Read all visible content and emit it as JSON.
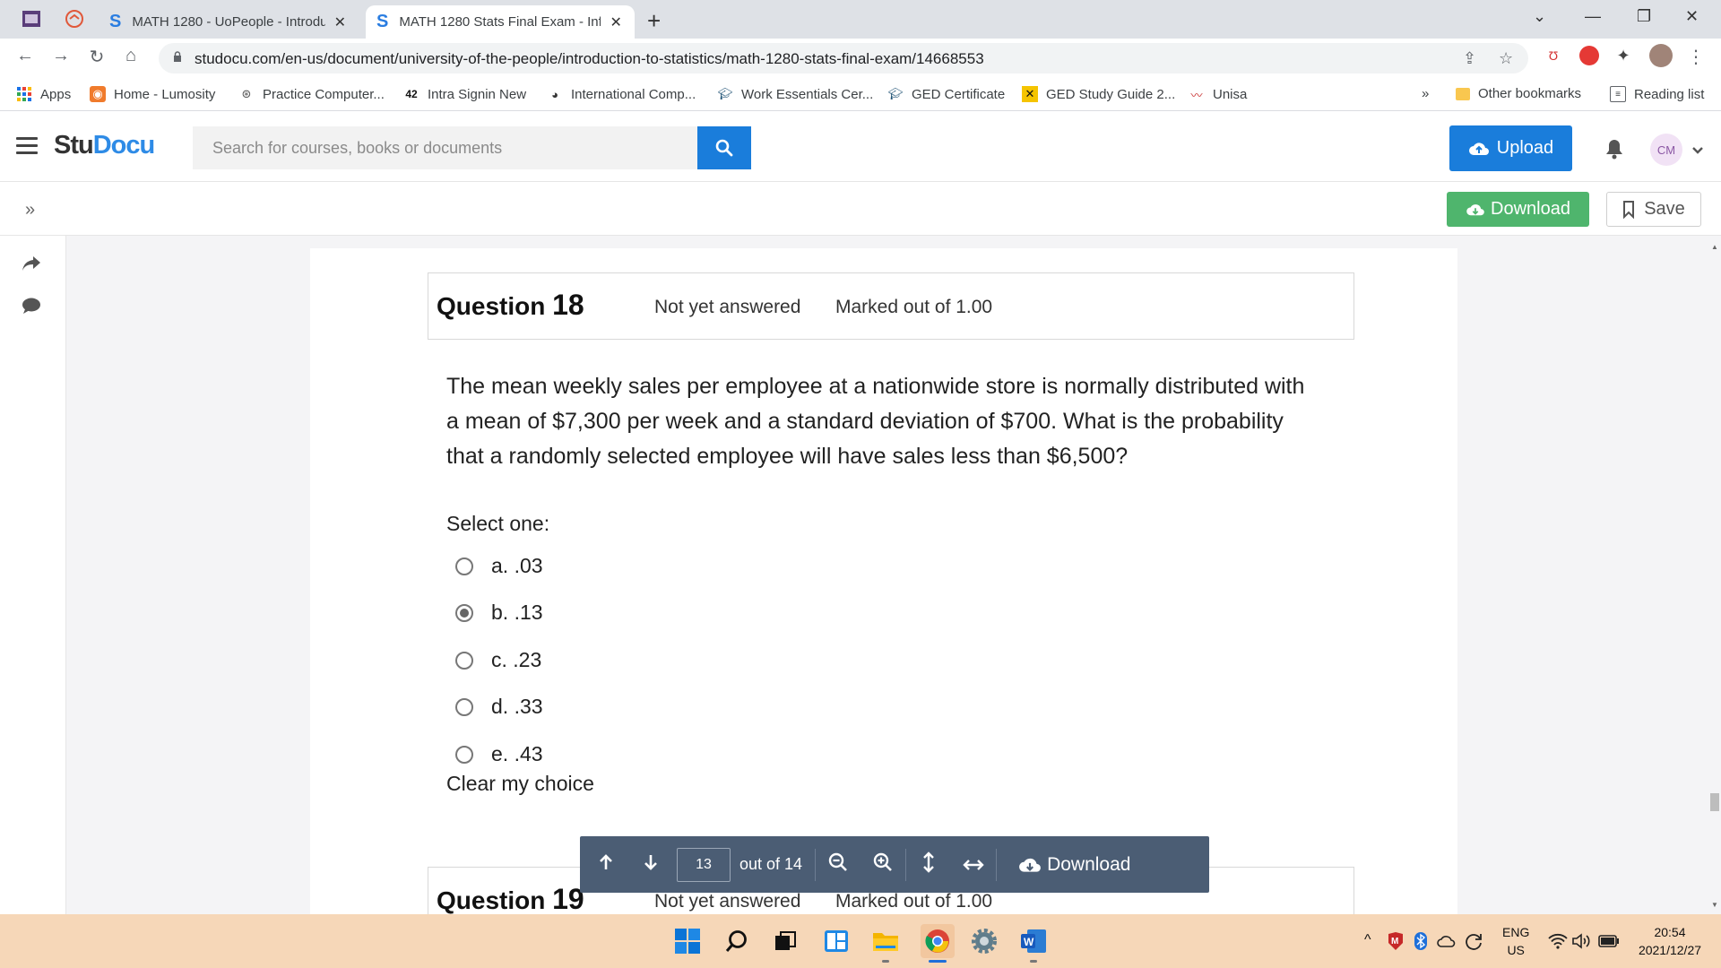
{
  "browser": {
    "tabs": [
      {
        "title": "MATH 1280 - UoPeople - Introdu",
        "active": false
      },
      {
        "title": "MATH 1280 Stats Final Exam - Inf",
        "active": true
      }
    ],
    "url": "studocu.com/en-us/document/university-of-the-people/introduction-to-statistics/math-1280-stats-final-exam/14668553",
    "bookmarks": [
      {
        "label": "Apps",
        "icon": "apps-grid-icon"
      },
      {
        "label": "Home - Lumosity",
        "icon": "lumosity-icon"
      },
      {
        "label": "Practice Computer...",
        "icon": "globe-icon"
      },
      {
        "label": "Intra Signin New",
        "icon": "intra-icon"
      },
      {
        "label": "International Comp...",
        "icon": "globe-icon"
      },
      {
        "label": "Work Essentials Cer...",
        "icon": "grad-cap-icon"
      },
      {
        "label": "GED Certificate",
        "icon": "grad-cap-icon"
      },
      {
        "label": "GED Study Guide 2...",
        "icon": "ged-icon"
      },
      {
        "label": "Unisa",
        "icon": "unisa-icon"
      }
    ],
    "more_bookmarks": "»",
    "other_bookmarks": "Other bookmarks",
    "reading_list": "Reading list"
  },
  "header": {
    "logo_stu": "Stu",
    "logo_docu": "Docu",
    "search_placeholder": "Search for courses, books or documents",
    "upload_label": "Upload",
    "avatar_initials": "CM"
  },
  "subheader": {
    "download_label": "Download",
    "save_label": "Save"
  },
  "question": {
    "label": "Question",
    "number": "18",
    "status": "Not yet answered",
    "marked": "Marked out of 1.00",
    "text": "The mean weekly sales per employee at a nationwide store is normally distributed with a mean of $7,300 per week and a standard deviation of $700.  What is the probability that a randomly selected employee will have sales less than $6,500?",
    "select_one": "Select one:",
    "options": [
      {
        "label": "a. .03",
        "selected": false
      },
      {
        "label": "b. .13",
        "selected": true
      },
      {
        "label": "c. .23",
        "selected": false
      },
      {
        "label": "d. .33",
        "selected": false
      },
      {
        "label": "e. .43",
        "selected": false
      }
    ],
    "clear_choice": "Clear my choice"
  },
  "next_question": {
    "label": "Question",
    "number": "19",
    "status": "Not yet answered",
    "marked": "Marked out of 1.00"
  },
  "page_toolbar": {
    "current_page": "13",
    "out_of": "out of 14",
    "download_label": "Download"
  },
  "taskbar": {
    "language": "ENG",
    "region": "US",
    "time": "20:54",
    "date": "2021/12/27"
  },
  "colors": {
    "accent_blue": "#1a7ddb",
    "download_green": "#4fb56d",
    "toolbar_slate": "#4b5d74",
    "taskbar": "#f6d7b8"
  }
}
